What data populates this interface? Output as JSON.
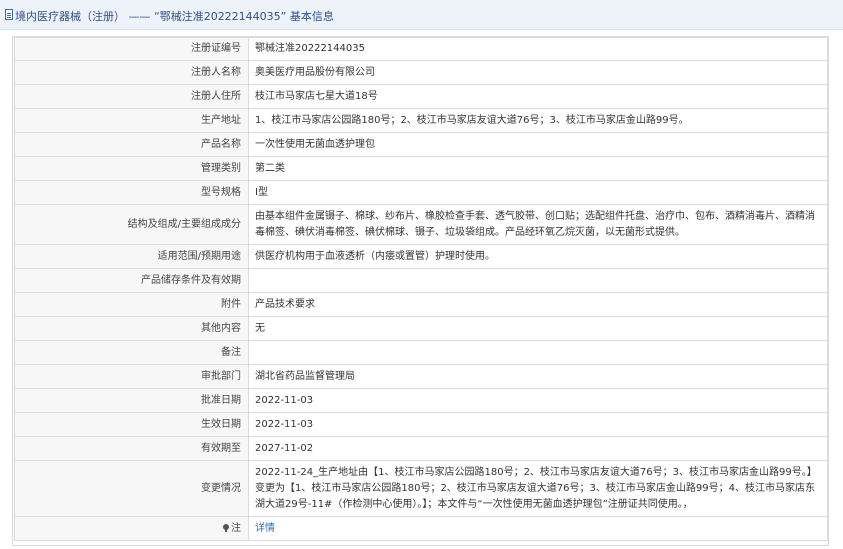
{
  "header": {
    "title": "境内医疗器械（注册） —— “鄂械注准20222144035” 基本信息"
  },
  "rows": [
    {
      "label": "注册证编号",
      "value": "鄂械注准20222144035"
    },
    {
      "label": "注册人名称",
      "value": "奥美医疗用品股份有限公司"
    },
    {
      "label": "注册人住所",
      "value": "枝江市马家店七星大道18号"
    },
    {
      "label": "生产地址",
      "value": "1、枝江市马家店公园路180号；2、枝江市马家店友谊大道76号；3、枝江市马家店金山路99号。"
    },
    {
      "label": "产品名称",
      "value": "一次性使用无菌血透护理包"
    },
    {
      "label": "管理类别",
      "value": "第二类"
    },
    {
      "label": "型号规格",
      "value": "Ⅰ型"
    },
    {
      "label": "结构及组成/主要组成成分",
      "value": "由基本组件金属镊子、棉球、纱布片、橡胶检查手套、透气胶带、创口贴；选配组件托盘、治疗巾、包布、酒精消毒片、酒精消毒棉签、碘伏消毒棉签、碘伏棉球、镊子、垃圾袋组成。产品经环氧乙烷灭菌，以无菌形式提供。"
    },
    {
      "label": "适用范围/预期用途",
      "value": "供医疗机构用于血液透析（内瘘或置管）护理时使用。"
    },
    {
      "label": "产品储存条件及有效期",
      "value": ""
    },
    {
      "label": "附件",
      "value": "产品技术要求"
    },
    {
      "label": "其他内容",
      "value": "无"
    },
    {
      "label": "备注",
      "value": ""
    },
    {
      "label": "审批部门",
      "value": "湖北省药品监督管理局"
    },
    {
      "label": "批准日期",
      "value": "2022-11-03"
    },
    {
      "label": "生效日期",
      "value": "2022-11-03"
    },
    {
      "label": "有效期至",
      "value": "2027-11-02"
    },
    {
      "label": "变更情况",
      "value": "2022-11-24_生产地址由【1、枝江市马家店公园路180号；2、枝江市马家店友谊大道76号；3、枝江市马家店金山路99号。】变更为【1、枝江市马家店公园路180号；2、枝江市马家店友谊大道76号；3、枝江市马家店金山路99号；4、枝江市马家店东湖大道29号-11#（作检测中心使用）。】；本文件与“一次性使用无菌血透护理包”注册证共同使用。，"
    }
  ],
  "note": {
    "icon": "pin-icon",
    "label": "注",
    "link": "详情"
  }
}
